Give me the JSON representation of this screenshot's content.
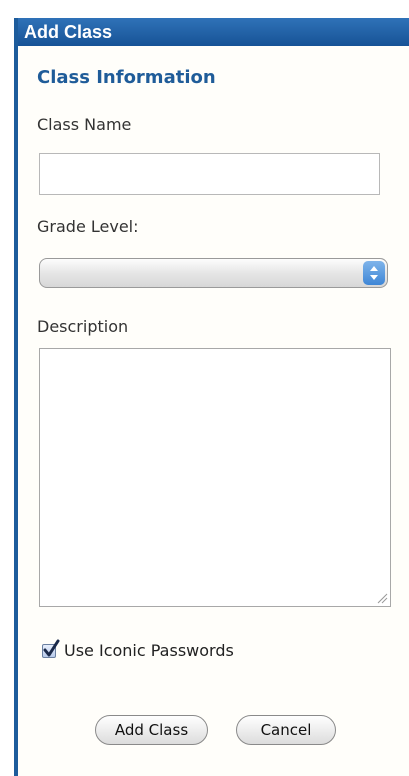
{
  "dialog": {
    "title": "Add Class"
  },
  "form": {
    "section_title": "Class Information",
    "class_name": {
      "label": "Class Name",
      "value": "",
      "placeholder": ""
    },
    "grade_level": {
      "label": "Grade Level:",
      "selected": ""
    },
    "description": {
      "label": "Description",
      "value": ""
    },
    "iconic_passwords": {
      "label": "Use Iconic Passwords",
      "checked": true
    }
  },
  "buttons": {
    "submit_label": "Add Class",
    "cancel_label": "Cancel"
  },
  "colors": {
    "accent": "#1d5c9c",
    "section_title": "#1f5c99",
    "select_arrow": "#3e86d6"
  },
  "icons": {
    "select": "chevron-up-down-icon",
    "checkbox": "checkmark-icon",
    "textarea": "resize-grip-icon"
  }
}
